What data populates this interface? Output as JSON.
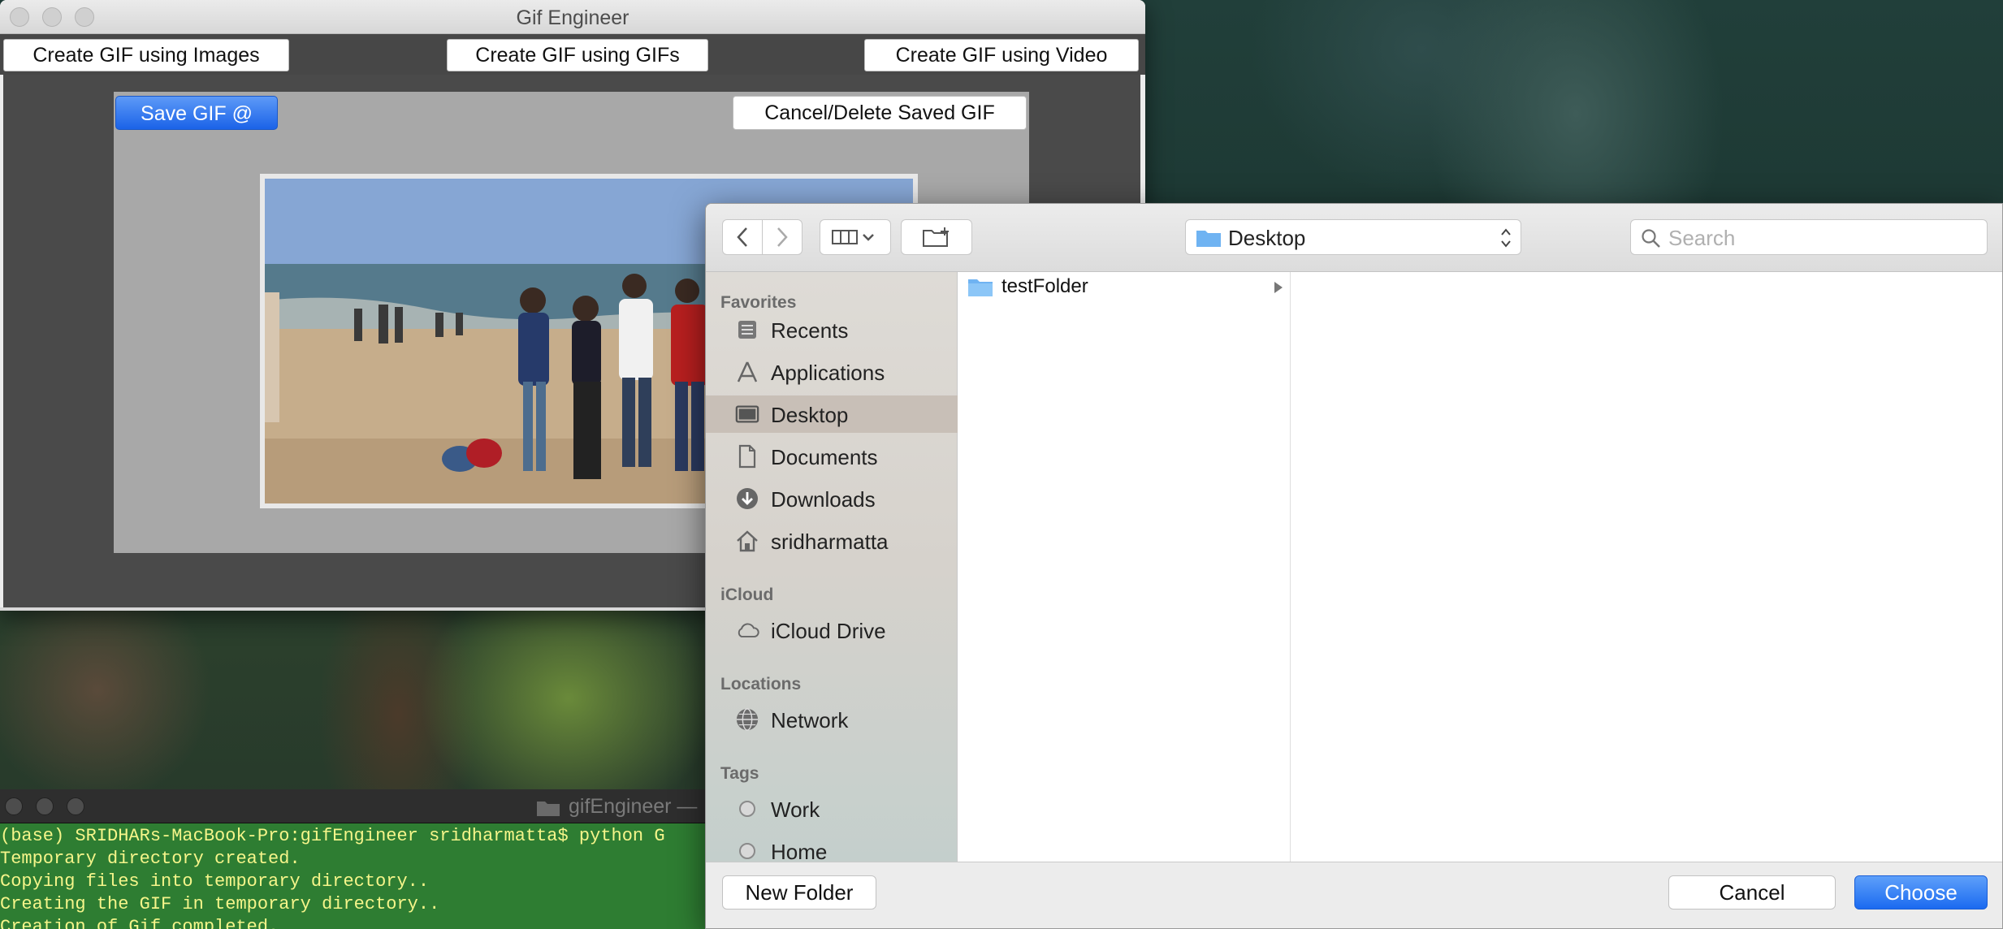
{
  "app": {
    "window_title": "Gif Engineer",
    "tabs": [
      {
        "label": "Create GIF using Images"
      },
      {
        "label": "Create GIF using GIFs"
      },
      {
        "label": "Create GIF using Video"
      }
    ],
    "save_button": "Save GIF @",
    "cancel_button": "Cancel/Delete Saved GIF"
  },
  "terminal": {
    "title": "gifEngineer —",
    "lines": [
      "(base) SRIDHARs-MacBook-Pro:gifEngineer sridharmatta$ python G",
      "Temporary directory created.",
      "Copying files into temporary directory..",
      "Creating the GIF in temporary directory..",
      "Creation of Gif completed."
    ]
  },
  "dialog": {
    "location": "Desktop",
    "search_placeholder": "Search",
    "sidebar": {
      "favorites_label": "Favorites",
      "favorites": [
        {
          "label": "Recents",
          "icon": "recents-icon"
        },
        {
          "label": "Applications",
          "icon": "applications-icon"
        },
        {
          "label": "Desktop",
          "icon": "desktop-icon",
          "selected": true
        },
        {
          "label": "Documents",
          "icon": "documents-icon"
        },
        {
          "label": "Downloads",
          "icon": "downloads-icon"
        },
        {
          "label": "sridharmatta",
          "icon": "home-icon"
        }
      ],
      "icloud_label": "iCloud",
      "icloud": [
        {
          "label": "iCloud Drive",
          "icon": "cloud-icon"
        }
      ],
      "locations_label": "Locations",
      "locations": [
        {
          "label": "Network",
          "icon": "network-icon"
        }
      ],
      "tags_label": "Tags",
      "tags": [
        {
          "label": "Work"
        },
        {
          "label": "Home"
        }
      ]
    },
    "files": [
      {
        "name": "testFolder",
        "type": "folder"
      }
    ],
    "new_folder_button": "New Folder",
    "cancel_button": "Cancel",
    "choose_button": "Choose",
    "colors": {
      "accent": "#1b6af0",
      "folder": "#6fb3f2"
    }
  }
}
